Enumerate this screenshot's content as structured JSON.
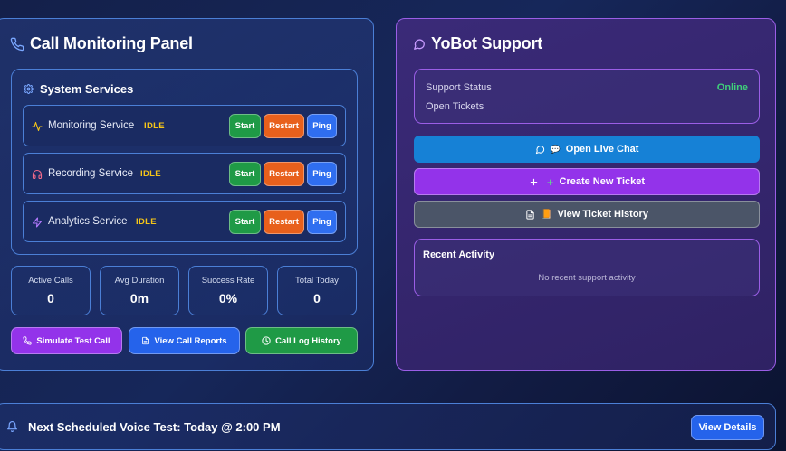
{
  "call_panel": {
    "title": "Call Monitoring Panel",
    "services_title": "System Services",
    "services": [
      {
        "name": "Monitoring Service",
        "status": "IDLE",
        "icon": "activity-icon"
      },
      {
        "name": "Recording Service",
        "status": "IDLE",
        "icon": "headphones-icon"
      },
      {
        "name": "Analytics Service",
        "status": "IDLE",
        "icon": "zap-icon"
      }
    ],
    "buttons": {
      "start": "Start",
      "restart": "Restart",
      "ping": "Ping"
    },
    "stats": [
      {
        "label": "Active Calls",
        "value": "0"
      },
      {
        "label": "Avg Duration",
        "value": "0m"
      },
      {
        "label": "Success Rate",
        "value": "0%"
      },
      {
        "label": "Total Today",
        "value": "0"
      }
    ],
    "actions": {
      "simulate": "Simulate Test Call",
      "reports": "View Call Reports",
      "history": "Call Log History"
    }
  },
  "support_panel": {
    "title": "YoBot Support",
    "support_status_label": "Support Status",
    "support_status_value": "Online",
    "open_tickets_label": "Open Tickets",
    "open_chat": "Open Live Chat",
    "open_chat_emoji": "💬",
    "create_ticket": "Create New Ticket",
    "create_ticket_glyph": "+",
    "view_history": "View Ticket History",
    "view_history_emoji": "📙",
    "recent_title": "Recent Activity",
    "recent_empty": "No recent support activity"
  },
  "bottom_bar": {
    "text": "Next Scheduled Voice Test: Today @ 2:00 PM",
    "details": "View Details"
  },
  "colors": {
    "start_green": "#1f9a46",
    "restart_orange": "#e8601c",
    "ping_blue": "#2f6ef0",
    "idle_yellow": "#f5c518",
    "online_green": "#3fd17a",
    "purple_accent": "#9333ea",
    "chat_blue": "#1681d6"
  }
}
